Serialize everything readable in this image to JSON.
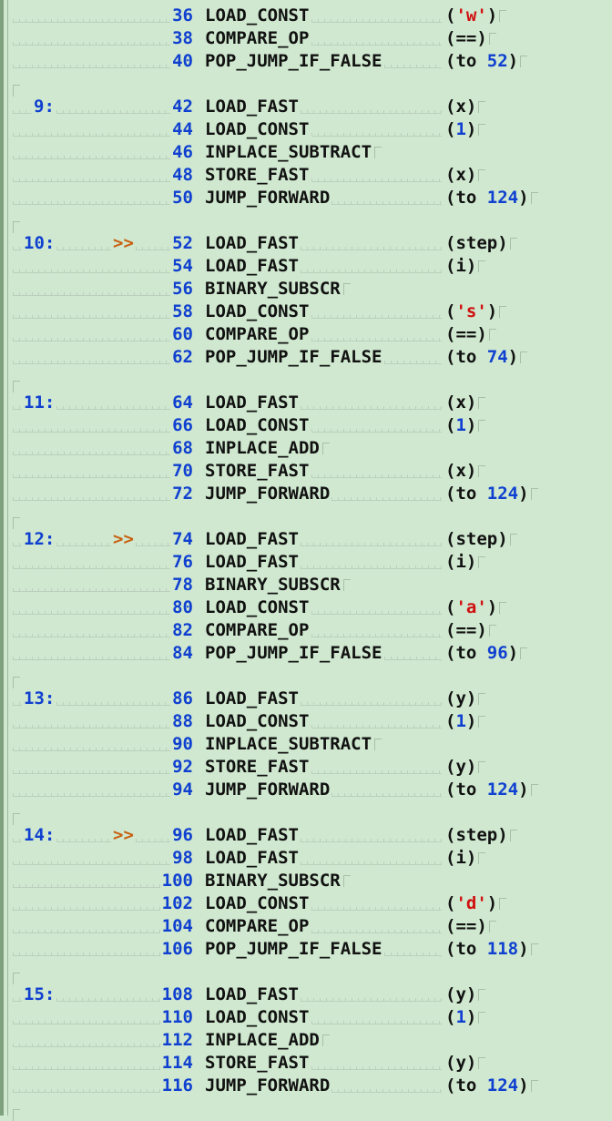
{
  "lines": [
    {
      "kind": "instr",
      "lineno": "",
      "jump": "",
      "offset": "36",
      "opcode": "LOAD_CONST",
      "arg": {
        "pre": "(",
        "val": "'w'",
        "type": "str",
        "post": ")"
      }
    },
    {
      "kind": "instr",
      "lineno": "",
      "jump": "",
      "offset": "38",
      "opcode": "COMPARE_OP",
      "arg": {
        "pre": "(",
        "val": "==",
        "type": "plain",
        "post": ")"
      }
    },
    {
      "kind": "instr",
      "lineno": "",
      "jump": "",
      "offset": "40",
      "opcode": "POP_JUMP_IF_FALSE",
      "arg": {
        "pre": "(to ",
        "val": "52",
        "type": "num",
        "post": ")"
      }
    },
    {
      "kind": "blank"
    },
    {
      "kind": "instr",
      "lineno": "9:",
      "jump": "",
      "offset": "42",
      "opcode": "LOAD_FAST",
      "arg": {
        "pre": "(",
        "val": "x",
        "type": "plain",
        "post": ")"
      }
    },
    {
      "kind": "instr",
      "lineno": "",
      "jump": "",
      "offset": "44",
      "opcode": "LOAD_CONST",
      "arg": {
        "pre": "(",
        "val": "1",
        "type": "num",
        "post": ")"
      }
    },
    {
      "kind": "instr",
      "lineno": "",
      "jump": "",
      "offset": "46",
      "opcode": "INPLACE_SUBTRACT",
      "arg": null
    },
    {
      "kind": "instr",
      "lineno": "",
      "jump": "",
      "offset": "48",
      "opcode": "STORE_FAST",
      "arg": {
        "pre": "(",
        "val": "x",
        "type": "plain",
        "post": ")"
      }
    },
    {
      "kind": "instr",
      "lineno": "",
      "jump": "",
      "offset": "50",
      "opcode": "JUMP_FORWARD",
      "arg": {
        "pre": "(to ",
        "val": "124",
        "type": "num",
        "post": ")"
      }
    },
    {
      "kind": "blank"
    },
    {
      "kind": "instr",
      "lineno": "10:",
      "jump": ">>",
      "offset": "52",
      "opcode": "LOAD_FAST",
      "arg": {
        "pre": "(",
        "val": "step",
        "type": "plain",
        "post": ")"
      }
    },
    {
      "kind": "instr",
      "lineno": "",
      "jump": "",
      "offset": "54",
      "opcode": "LOAD_FAST",
      "arg": {
        "pre": "(",
        "val": "i",
        "type": "plain",
        "post": ")"
      }
    },
    {
      "kind": "instr",
      "lineno": "",
      "jump": "",
      "offset": "56",
      "opcode": "BINARY_SUBSCR",
      "arg": null
    },
    {
      "kind": "instr",
      "lineno": "",
      "jump": "",
      "offset": "58",
      "opcode": "LOAD_CONST",
      "arg": {
        "pre": "(",
        "val": "'s'",
        "type": "str",
        "post": ")"
      }
    },
    {
      "kind": "instr",
      "lineno": "",
      "jump": "",
      "offset": "60",
      "opcode": "COMPARE_OP",
      "arg": {
        "pre": "(",
        "val": "==",
        "type": "plain",
        "post": ")"
      }
    },
    {
      "kind": "instr",
      "lineno": "",
      "jump": "",
      "offset": "62",
      "opcode": "POP_JUMP_IF_FALSE",
      "arg": {
        "pre": "(to ",
        "val": "74",
        "type": "num",
        "post": ")"
      }
    },
    {
      "kind": "blank"
    },
    {
      "kind": "instr",
      "lineno": "11:",
      "jump": "",
      "offset": "64",
      "opcode": "LOAD_FAST",
      "arg": {
        "pre": "(",
        "val": "x",
        "type": "plain",
        "post": ")"
      }
    },
    {
      "kind": "instr",
      "lineno": "",
      "jump": "",
      "offset": "66",
      "opcode": "LOAD_CONST",
      "arg": {
        "pre": "(",
        "val": "1",
        "type": "num",
        "post": ")"
      }
    },
    {
      "kind": "instr",
      "lineno": "",
      "jump": "",
      "offset": "68",
      "opcode": "INPLACE_ADD",
      "arg": null
    },
    {
      "kind": "instr",
      "lineno": "",
      "jump": "",
      "offset": "70",
      "opcode": "STORE_FAST",
      "arg": {
        "pre": "(",
        "val": "x",
        "type": "plain",
        "post": ")"
      }
    },
    {
      "kind": "instr",
      "lineno": "",
      "jump": "",
      "offset": "72",
      "opcode": "JUMP_FORWARD",
      "arg": {
        "pre": "(to ",
        "val": "124",
        "type": "num",
        "post": ")"
      }
    },
    {
      "kind": "blank"
    },
    {
      "kind": "instr",
      "lineno": "12:",
      "jump": ">>",
      "offset": "74",
      "opcode": "LOAD_FAST",
      "arg": {
        "pre": "(",
        "val": "step",
        "type": "plain",
        "post": ")"
      }
    },
    {
      "kind": "instr",
      "lineno": "",
      "jump": "",
      "offset": "76",
      "opcode": "LOAD_FAST",
      "arg": {
        "pre": "(",
        "val": "i",
        "type": "plain",
        "post": ")"
      }
    },
    {
      "kind": "instr",
      "lineno": "",
      "jump": "",
      "offset": "78",
      "opcode": "BINARY_SUBSCR",
      "arg": null
    },
    {
      "kind": "instr",
      "lineno": "",
      "jump": "",
      "offset": "80",
      "opcode": "LOAD_CONST",
      "arg": {
        "pre": "(",
        "val": "'a'",
        "type": "str",
        "post": ")"
      }
    },
    {
      "kind": "instr",
      "lineno": "",
      "jump": "",
      "offset": "82",
      "opcode": "COMPARE_OP",
      "arg": {
        "pre": "(",
        "val": "==",
        "type": "plain",
        "post": ")"
      }
    },
    {
      "kind": "instr",
      "lineno": "",
      "jump": "",
      "offset": "84",
      "opcode": "POP_JUMP_IF_FALSE",
      "arg": {
        "pre": "(to ",
        "val": "96",
        "type": "num",
        "post": ")"
      }
    },
    {
      "kind": "blank"
    },
    {
      "kind": "instr",
      "lineno": "13:",
      "jump": "",
      "offset": "86",
      "opcode": "LOAD_FAST",
      "arg": {
        "pre": "(",
        "val": "y",
        "type": "plain",
        "post": ")"
      }
    },
    {
      "kind": "instr",
      "lineno": "",
      "jump": "",
      "offset": "88",
      "opcode": "LOAD_CONST",
      "arg": {
        "pre": "(",
        "val": "1",
        "type": "num",
        "post": ")"
      }
    },
    {
      "kind": "instr",
      "lineno": "",
      "jump": "",
      "offset": "90",
      "opcode": "INPLACE_SUBTRACT",
      "arg": null
    },
    {
      "kind": "instr",
      "lineno": "",
      "jump": "",
      "offset": "92",
      "opcode": "STORE_FAST",
      "arg": {
        "pre": "(",
        "val": "y",
        "type": "plain",
        "post": ")"
      }
    },
    {
      "kind": "instr",
      "lineno": "",
      "jump": "",
      "offset": "94",
      "opcode": "JUMP_FORWARD",
      "arg": {
        "pre": "(to ",
        "val": "124",
        "type": "num",
        "post": ")"
      }
    },
    {
      "kind": "blank"
    },
    {
      "kind": "instr",
      "lineno": "14:",
      "jump": ">>",
      "offset": "96",
      "opcode": "LOAD_FAST",
      "arg": {
        "pre": "(",
        "val": "step",
        "type": "plain",
        "post": ")"
      }
    },
    {
      "kind": "instr",
      "lineno": "",
      "jump": "",
      "offset": "98",
      "opcode": "LOAD_FAST",
      "arg": {
        "pre": "(",
        "val": "i",
        "type": "plain",
        "post": ")"
      }
    },
    {
      "kind": "instr",
      "lineno": "",
      "jump": "",
      "offset": "100",
      "opcode": "BINARY_SUBSCR",
      "arg": null
    },
    {
      "kind": "instr",
      "lineno": "",
      "jump": "",
      "offset": "102",
      "opcode": "LOAD_CONST",
      "arg": {
        "pre": "(",
        "val": "'d'",
        "type": "str",
        "post": ")"
      }
    },
    {
      "kind": "instr",
      "lineno": "",
      "jump": "",
      "offset": "104",
      "opcode": "COMPARE_OP",
      "arg": {
        "pre": "(",
        "val": "==",
        "type": "plain",
        "post": ")"
      }
    },
    {
      "kind": "instr",
      "lineno": "",
      "jump": "",
      "offset": "106",
      "opcode": "POP_JUMP_IF_FALSE",
      "arg": {
        "pre": "(to ",
        "val": "118",
        "type": "num",
        "post": ")"
      }
    },
    {
      "kind": "blank"
    },
    {
      "kind": "instr",
      "lineno": "15:",
      "jump": "",
      "offset": "108",
      "opcode": "LOAD_FAST",
      "arg": {
        "pre": "(",
        "val": "y",
        "type": "plain",
        "post": ")"
      }
    },
    {
      "kind": "instr",
      "lineno": "",
      "jump": "",
      "offset": "110",
      "opcode": "LOAD_CONST",
      "arg": {
        "pre": "(",
        "val": "1",
        "type": "num",
        "post": ")"
      }
    },
    {
      "kind": "instr",
      "lineno": "",
      "jump": "",
      "offset": "112",
      "opcode": "INPLACE_ADD",
      "arg": null
    },
    {
      "kind": "instr",
      "lineno": "",
      "jump": "",
      "offset": "114",
      "opcode": "STORE_FAST",
      "arg": {
        "pre": "(",
        "val": "y",
        "type": "plain",
        "post": ")"
      }
    },
    {
      "kind": "instr",
      "lineno": "",
      "jump": "",
      "offset": "116",
      "opcode": "JUMP_FORWARD",
      "arg": {
        "pre": "(to ",
        "val": "124",
        "type": "num",
        "post": ")"
      }
    },
    {
      "kind": "blank"
    }
  ],
  "colors": {
    "background": "#cfe8cf",
    "number": "#1040d0",
    "string": "#d01010",
    "jump_marker": "#c86010",
    "text": "#111111"
  }
}
